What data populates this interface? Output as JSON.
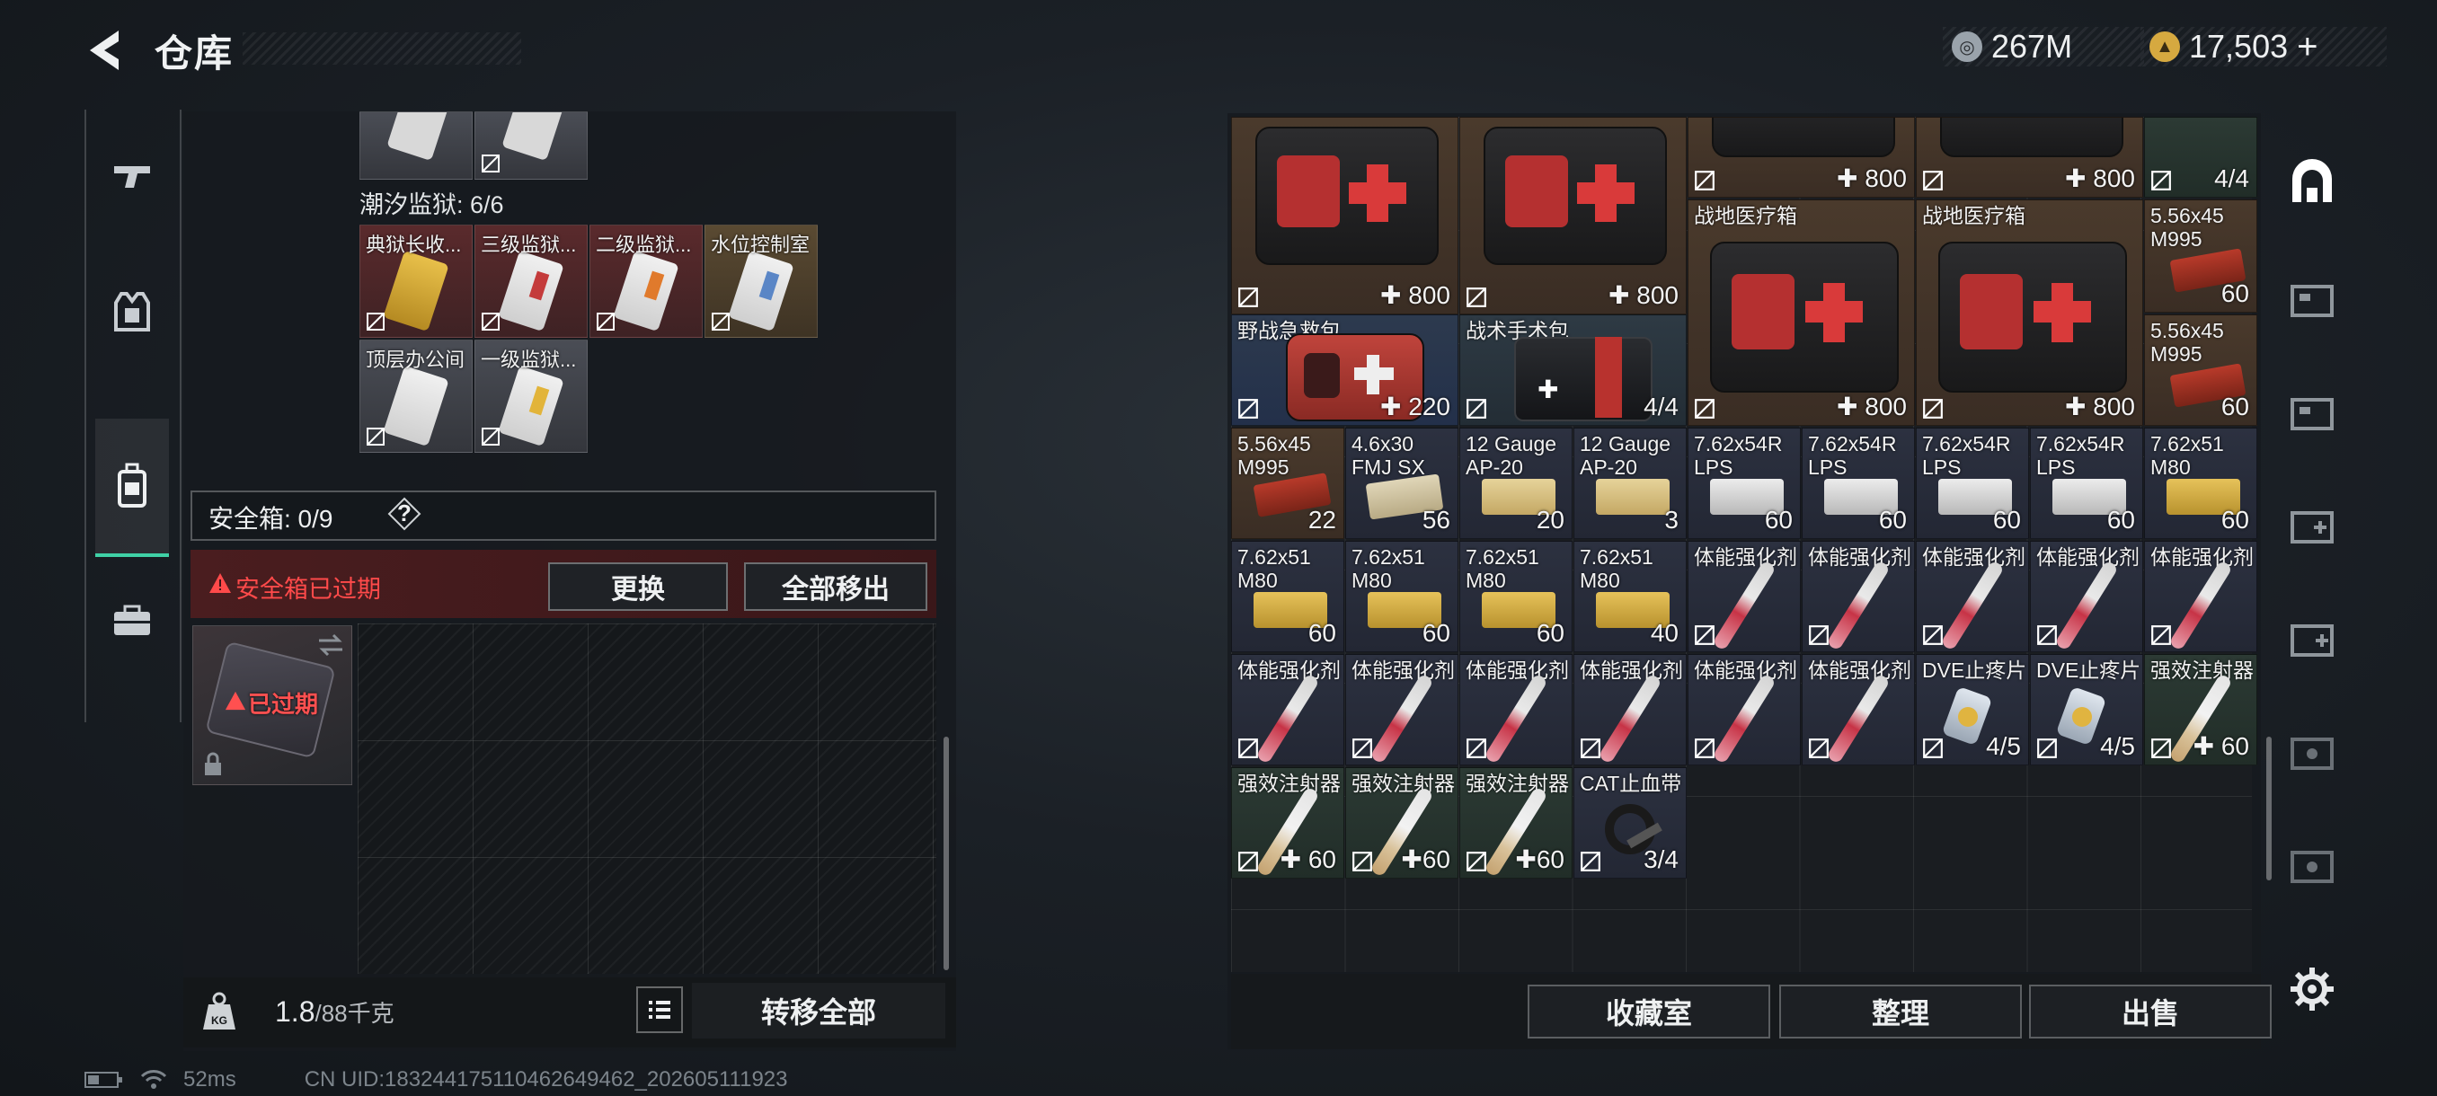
{
  "header": {
    "title": "仓库",
    "currency_silver": "267M",
    "currency_gold": "17,503",
    "plus": "+"
  },
  "left_panel": {
    "prison_label": "潮汐监狱: 6/6",
    "keys": [
      {
        "label": "典狱长收..."
      },
      {
        "label": "三级监狱..."
      },
      {
        "label": "二级监狱..."
      },
      {
        "label": "水位控制室"
      },
      {
        "label": "顶层办公间"
      },
      {
        "label": "一级监狱..."
      }
    ],
    "safebox_label": "安全箱: 0/9",
    "help": "?",
    "expired_warning": "安全箱已过期",
    "replace_button": "更换",
    "remove_all_button": "全部移出",
    "safebox_expired": "已过期",
    "weight_current": "1.8",
    "weight_max": "/88千克",
    "transfer_all": "转移全部"
  },
  "inventory": [
    {
      "name": "",
      "count": "800",
      "plus": true
    },
    {
      "name": "",
      "count": "800",
      "plus": true
    },
    {
      "name": "",
      "count": "800",
      "plus": true
    },
    {
      "name": "",
      "count": "800",
      "plus": true
    },
    {
      "name": "",
      "count": "4/4",
      "plus": false
    },
    {
      "name": "战地医疗箱",
      "count": "800",
      "plus": true
    },
    {
      "name": "战地医疗箱",
      "count": "800",
      "plus": true
    },
    {
      "name": "5.56x45\nM995",
      "count": "60"
    },
    {
      "name": "野战急救包",
      "count": "220",
      "plus": true
    },
    {
      "name": "战术手术包",
      "count": "4/4"
    },
    {
      "name": "5.56x45\nM995",
      "count": "60"
    },
    {
      "name": "5.56x45\nM995",
      "count": "22"
    },
    {
      "name": "4.6x30\nFMJ SX",
      "count": "56"
    },
    {
      "name": "12 Gauge\nAP-20",
      "count": "20"
    },
    {
      "name": "12 Gauge\nAP-20",
      "count": "3"
    },
    {
      "name": "7.62x54R\nLPS",
      "count": "60"
    },
    {
      "name": "7.62x54R\nLPS",
      "count": "60"
    },
    {
      "name": "7.62x54R\nLPS",
      "count": "60"
    },
    {
      "name": "7.62x54R\nLPS",
      "count": "60"
    },
    {
      "name": "7.62x51\nM80",
      "count": "60"
    },
    {
      "name": "7.62x51\nM80",
      "count": "60"
    },
    {
      "name": "7.62x51\nM80",
      "count": "60"
    },
    {
      "name": "7.62x51\nM80",
      "count": "60"
    },
    {
      "name": "7.62x51\nM80",
      "count": "40"
    },
    {
      "name": "体能强化剂",
      "count": ""
    },
    {
      "name": "体能强化剂",
      "count": ""
    },
    {
      "name": "体能强化剂",
      "count": ""
    },
    {
      "name": "体能强化剂",
      "count": ""
    },
    {
      "name": "体能强化剂",
      "count": ""
    },
    {
      "name": "体能强化剂",
      "count": ""
    },
    {
      "name": "体能强化剂",
      "count": ""
    },
    {
      "name": "体能强化剂",
      "count": ""
    },
    {
      "name": "体能强化剂",
      "count": ""
    },
    {
      "name": "体能强化剂",
      "count": ""
    },
    {
      "name": "体能强化剂",
      "count": ""
    },
    {
      "name": "DVE止疼片",
      "count": "4/5"
    },
    {
      "name": "DVE止疼片",
      "count": "4/5"
    },
    {
      "name": "强效注射器",
      "count": "60",
      "plus": true
    },
    {
      "name": "强效注射器",
      "count": "60",
      "plus": true
    },
    {
      "name": "强效注射器",
      "count": "60",
      "plus": true
    },
    {
      "name": "强效注射器",
      "count": "60",
      "plus": true
    },
    {
      "name": "CAT止血带",
      "count": "3/4"
    }
  ],
  "bottom_buttons": {
    "vault": "收藏室",
    "sort": "整理",
    "sell": "出售"
  },
  "status": {
    "ping": "52ms",
    "uid": "CN UID:1832441751104626494​62_202605111923"
  },
  "icons": {
    "back": "back-arrow-icon",
    "weapon_tab": "pistol-icon",
    "armor_tab": "armor-vest-icon",
    "backpack_tab": "backpack-icon",
    "case_tab": "briefcase-icon",
    "settings": "gear-icon"
  },
  "colors": {
    "accent_green": "#3fd1a6",
    "warning_red": "#ff4a4a"
  }
}
